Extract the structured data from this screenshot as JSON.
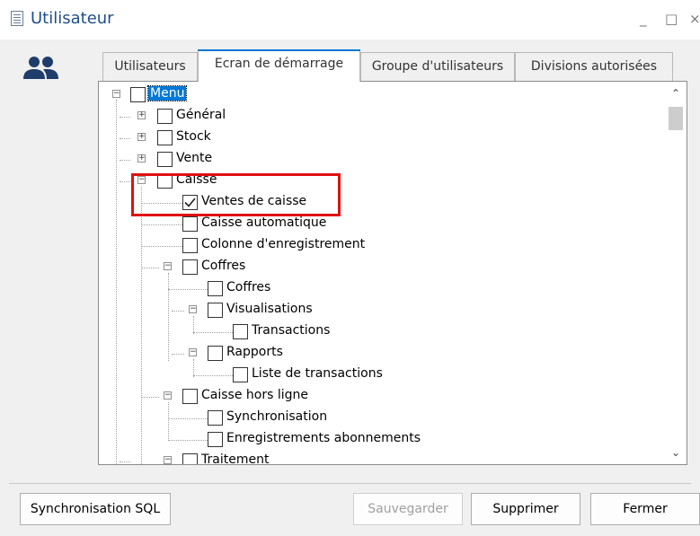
{
  "window": {
    "title": "Utilisateur",
    "controls": [
      "_",
      "□",
      "×"
    ]
  },
  "tabs": [
    {
      "label": "Utilisateurs"
    },
    {
      "label": "Ecran de démarrage"
    },
    {
      "label": "Groupe d'utilisateurs"
    },
    {
      "label": "Divisions autorisées"
    }
  ],
  "tree": {
    "root": {
      "label": "Menu",
      "expanded": true,
      "checked": false
    },
    "items": {
      "general": {
        "label": "Général",
        "checked": false,
        "expanded": false
      },
      "stock": {
        "label": "Stock",
        "checked": false,
        "expanded": false
      },
      "vente": {
        "label": "Vente",
        "checked": false,
        "expanded": false
      },
      "caisse": {
        "label": "Caisse",
        "checked": false,
        "expanded": true
      },
      "ventes_caisse": {
        "label": "Ventes de caisse",
        "checked": true
      },
      "caisse_auto": {
        "label": "Caisse automatique",
        "checked": false
      },
      "colonne": {
        "label": "Colonne d'enregistrement",
        "checked": false
      },
      "coffres": {
        "label": "Coffres",
        "checked": false,
        "expanded": true
      },
      "coffres_child": {
        "label": "Coffres",
        "checked": false
      },
      "visualisations": {
        "label": "Visualisations",
        "checked": false,
        "expanded": true
      },
      "transactions": {
        "label": "Transactions",
        "checked": false
      },
      "rapports": {
        "label": "Rapports",
        "checked": false,
        "expanded": true
      },
      "liste_transactions": {
        "label": "Liste de transactions",
        "checked": false
      },
      "hors_ligne": {
        "label": "Caisse hors ligne",
        "checked": false,
        "expanded": true
      },
      "synchronisation": {
        "label": "Synchronisation",
        "checked": false
      },
      "abonnements": {
        "label": "Enregistrements abonnements",
        "checked": false
      },
      "traitement": {
        "label": "Traitement",
        "checked": false,
        "expanded": true
      }
    }
  },
  "highlight_color": "#e01010",
  "selection_color": "#0078d7",
  "buttons": {
    "sync": "Synchronisation SQL",
    "save": "Sauvegarder",
    "delete": "Supprimer",
    "close": "Fermer"
  }
}
